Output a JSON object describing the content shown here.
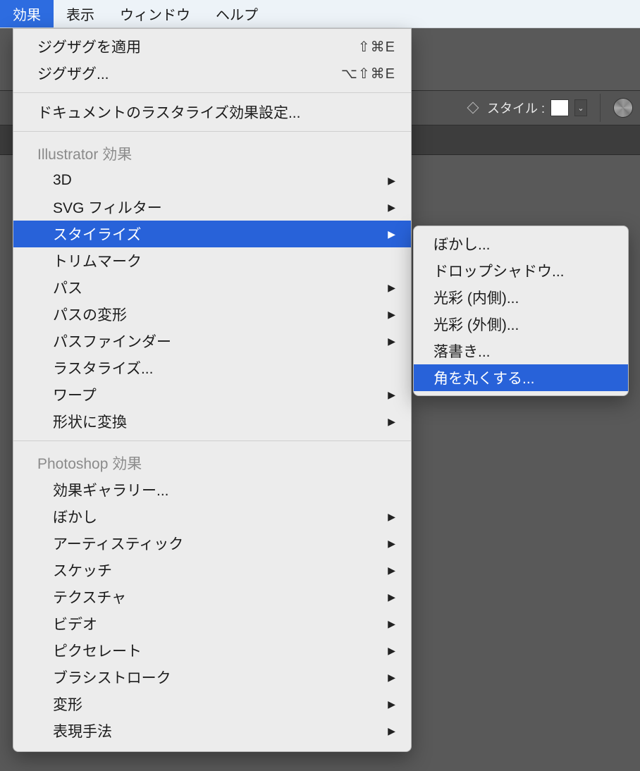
{
  "menubar": {
    "items": [
      "効果",
      "表示",
      "ウィンドウ",
      "ヘルプ"
    ],
    "activeIndex": 0
  },
  "toolbar": {
    "styleLabel": "スタイル :"
  },
  "dropdown": {
    "top": [
      {
        "label": "ジグザグを適用",
        "shortcut": "⇧⌘E"
      },
      {
        "label": "ジグザグ...",
        "shortcut": "⌥⇧⌘E"
      }
    ],
    "docRaster": "ドキュメントのラスタライズ効果設定...",
    "sectionIllustrator": "Illustrator 効果",
    "ill": [
      {
        "label": "3D",
        "sub": true
      },
      {
        "label": "SVG フィルター",
        "sub": true
      },
      {
        "label": "スタイライズ",
        "sub": true,
        "selected": true
      },
      {
        "label": "トリムマーク",
        "sub": false
      },
      {
        "label": "パス",
        "sub": true
      },
      {
        "label": "パスの変形",
        "sub": true
      },
      {
        "label": "パスファインダー",
        "sub": true
      },
      {
        "label": "ラスタライズ...",
        "sub": false
      },
      {
        "label": "ワープ",
        "sub": true
      },
      {
        "label": "形状に変換",
        "sub": true
      }
    ],
    "sectionPhotoshop": "Photoshop 効果",
    "ps": [
      {
        "label": "効果ギャラリー...",
        "sub": false
      },
      {
        "label": "ぼかし",
        "sub": true
      },
      {
        "label": "アーティスティック",
        "sub": true
      },
      {
        "label": "スケッチ",
        "sub": true
      },
      {
        "label": "テクスチャ",
        "sub": true
      },
      {
        "label": "ビデオ",
        "sub": true
      },
      {
        "label": "ピクセレート",
        "sub": true
      },
      {
        "label": "ブラシストローク",
        "sub": true
      },
      {
        "label": "変形",
        "sub": true
      },
      {
        "label": "表現手法",
        "sub": true
      }
    ]
  },
  "submenu": {
    "items": [
      {
        "label": "ぼかし..."
      },
      {
        "label": "ドロップシャドウ..."
      },
      {
        "label": "光彩 (内側)..."
      },
      {
        "label": "光彩 (外側)..."
      },
      {
        "label": "落書き..."
      },
      {
        "label": "角を丸くする...",
        "selected": true
      }
    ]
  }
}
